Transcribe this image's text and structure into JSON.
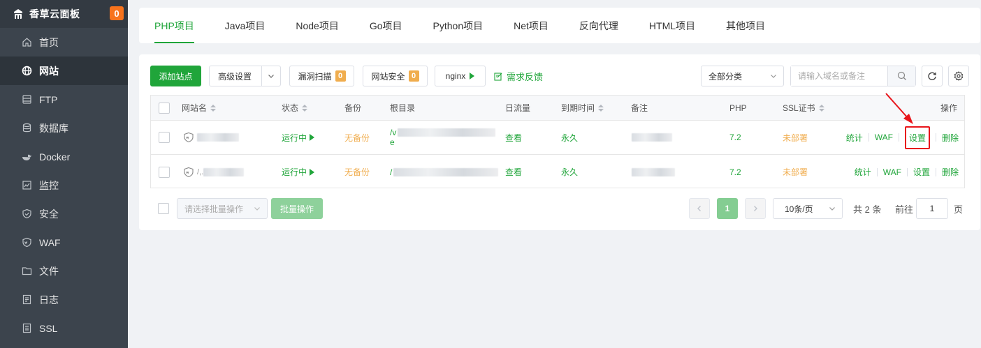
{
  "sidebar": {
    "title": "香草云面板",
    "notification_count": "0",
    "items": [
      {
        "label": "首页",
        "icon": "home-icon"
      },
      {
        "label": "网站",
        "icon": "globe-icon"
      },
      {
        "label": "FTP",
        "icon": "ftp-icon"
      },
      {
        "label": "数据库",
        "icon": "database-icon"
      },
      {
        "label": "Docker",
        "icon": "docker-icon"
      },
      {
        "label": "监控",
        "icon": "monitor-icon"
      },
      {
        "label": "安全",
        "icon": "shield-icon"
      },
      {
        "label": "WAF",
        "icon": "waf-icon"
      },
      {
        "label": "文件",
        "icon": "folder-icon"
      },
      {
        "label": "日志",
        "icon": "log-icon"
      },
      {
        "label": "SSL",
        "icon": "ssl-icon"
      }
    ],
    "active_index": 1
  },
  "tabs": [
    "PHP项目",
    "Java项目",
    "Node项目",
    "Go项目",
    "Python项目",
    "Net项目",
    "反向代理",
    "HTML项目",
    "其他项目"
  ],
  "toolbar": {
    "add_site": "添加站点",
    "advanced": "高级设置",
    "vuln_scan": "漏洞扫描",
    "vuln_count": "0",
    "site_security": "网站安全",
    "security_count": "0",
    "nginx": "nginx",
    "feedback": "需求反馈",
    "category": "全部分类",
    "search_placeholder": "请输入域名或备注"
  },
  "table": {
    "headers": {
      "name": "网站名",
      "status": "状态",
      "backup": "备份",
      "root": "根目录",
      "traffic": "日流量",
      "expire": "到期时间",
      "remark": "备注",
      "php": "PHP",
      "ssl": "SSL证书",
      "actions": "操作"
    },
    "rows": [
      {
        "name_prefix": "",
        "status": "运行中",
        "backup": "无备份",
        "root_line1": "/v",
        "root_line2": "e",
        "traffic": "查看",
        "expire": "永久",
        "php": "7.2",
        "ssl": "未部署",
        "actions": [
          "统计",
          "WAF",
          "设置",
          "删除"
        ]
      },
      {
        "name_prefix": "/,.",
        "status": "运行中",
        "backup": "无备份",
        "root_line1": "/",
        "root_line2": "",
        "traffic": "查看",
        "expire": "永久",
        "php": "7.2",
        "ssl": "未部署",
        "actions": [
          "统计",
          "WAF",
          "设置",
          "删除"
        ]
      }
    ]
  },
  "footer": {
    "batch_placeholder": "请选择批量操作",
    "batch_button": "批量操作",
    "current_page": "1",
    "page_size": "10条/页",
    "total": "共 2 条",
    "goto_label": "前往",
    "goto_value": "1",
    "page_unit": "页"
  },
  "colors": {
    "accent": "#20a53a",
    "sidebar_bg": "#3c444d",
    "badge": "#f7731c",
    "warning": "#f0ad4e",
    "highlight": "#e8151b"
  }
}
